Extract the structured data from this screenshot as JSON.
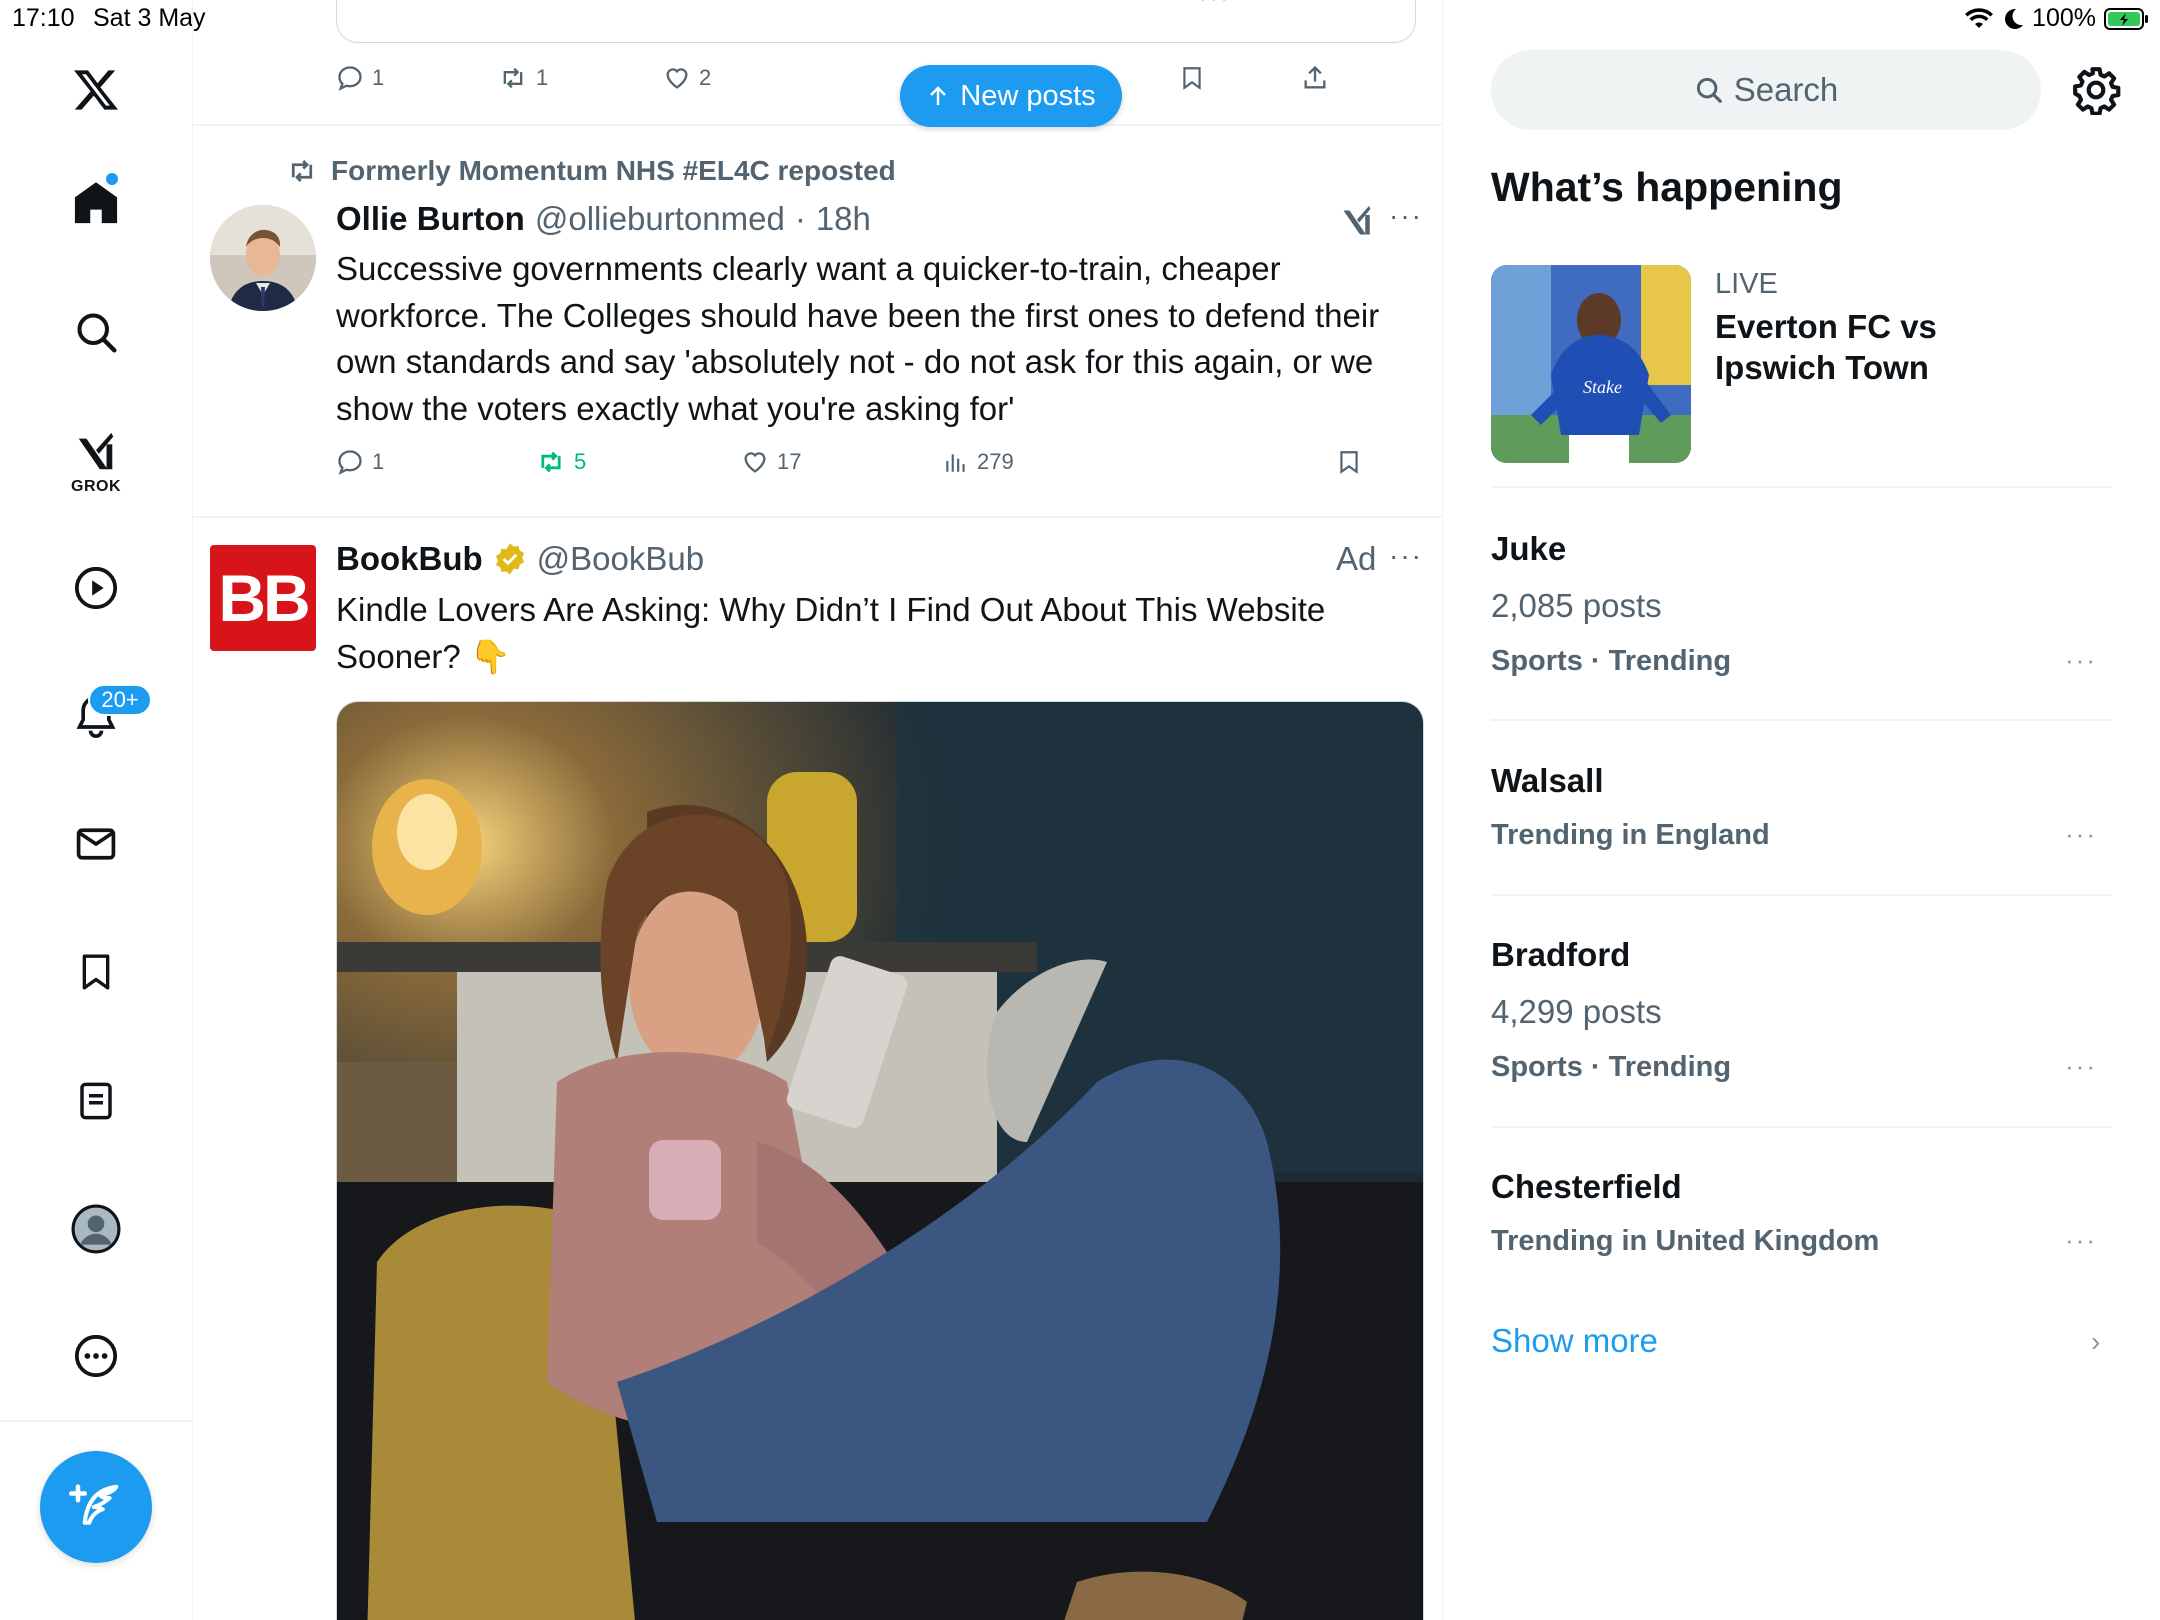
{
  "status": {
    "time": "17:10",
    "date": "Sat 3 May",
    "battery": "100%"
  },
  "sidebar": {
    "items": [
      {
        "name": "home",
        "icon": "home-icon"
      },
      {
        "name": "explore",
        "icon": "search-icon"
      },
      {
        "name": "grok",
        "icon": "grok-icon",
        "label": "GROK"
      },
      {
        "name": "video",
        "icon": "play-icon"
      },
      {
        "name": "notifications",
        "icon": "bell-icon",
        "badge": "20+"
      },
      {
        "name": "messages",
        "icon": "mail-icon"
      },
      {
        "name": "bookmarks",
        "icon": "bookmark-icon"
      },
      {
        "name": "lists",
        "icon": "list-icon"
      },
      {
        "name": "profile",
        "icon": "avatar-icon"
      },
      {
        "name": "more",
        "icon": "more-icon"
      }
    ],
    "compose": "compose-icon"
  },
  "feed": {
    "new_posts_label": "New posts",
    "prev_post": {
      "replies": "1",
      "reposts": "1",
      "likes": "2"
    },
    "post1": {
      "repost_by": "Formerly Momentum NHS #EL4C reposted",
      "name": "Ollie Burton",
      "handle": "@ollieburtonmed",
      "time": "18h",
      "text": "Successive governments clearly want a quicker-to-train, cheaper workforce. The Colleges should have been the first ones to defend their own standards and say 'absolutely not - do not ask for this again, or we show the voters exactly what you're asking for'",
      "replies": "1",
      "reposts": "5",
      "likes": "17",
      "views": "279"
    },
    "post2": {
      "logo_text": "BB",
      "name": "BookBub",
      "handle": "@BookBub",
      "ad_label": "Ad",
      "text": "Kindle Lovers Are Asking: Why Didn’t I Find Out About This Website Sooner? 👇"
    }
  },
  "right": {
    "search_placeholder": "Search",
    "section_title": "What’s happening",
    "live": {
      "label": "LIVE",
      "title": "Everton FC vs Ipswich Town"
    },
    "trends": [
      {
        "title": "Juke",
        "count": "2,085 posts",
        "context": "Sports · Trending"
      },
      {
        "title": "Walsall",
        "count": "",
        "context": "Trending in England"
      },
      {
        "title": "Bradford",
        "count": "4,299 posts",
        "context": "Sports · Trending"
      },
      {
        "title": "Chesterfield",
        "count": "",
        "context": "Trending in United Kingdom"
      }
    ],
    "show_more": "Show more"
  },
  "colors": {
    "accent": "#1d9bf0",
    "repost_green": "#00ba7c",
    "muted": "#536471",
    "ad_red": "#d8141b"
  }
}
